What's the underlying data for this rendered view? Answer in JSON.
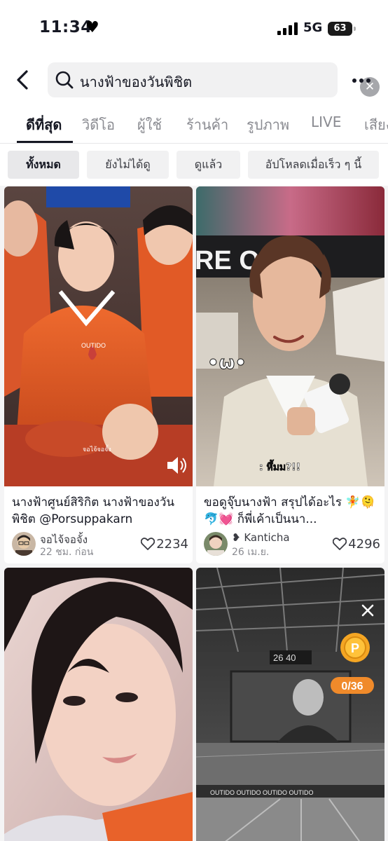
{
  "status_bar": {
    "time": "11:34",
    "network": "5G",
    "battery": "63"
  },
  "search": {
    "query": "นางฟ้าของวันพิชิต"
  },
  "tabs": [
    {
      "label": "ดีที่สุด",
      "active": true
    },
    {
      "label": "วิดีโอ"
    },
    {
      "label": "ผู้ใช้"
    },
    {
      "label": "ร้านค้า"
    },
    {
      "label": "รูปภาพ"
    },
    {
      "label": "LIVE"
    },
    {
      "label": "เสียง"
    }
  ],
  "filters": [
    {
      "label": "ทั้งหมด",
      "active": true
    },
    {
      "label": "ยังไม่ได้ดู"
    },
    {
      "label": "ดูแล้ว"
    },
    {
      "label": "อัปโหลดเมื่อเร็ว ๆ นี้"
    }
  ],
  "videos": [
    {
      "caption": "นางฟ้าศูนย์สิริกิต นางฟ้าของวันพิชิต @Porsuppakarn",
      "overlay_text": "จอไจ้จอจั้ง",
      "author": "จอไจ้จอจั้ง",
      "time": "22 ชม. ก่อน",
      "likes": "2234",
      "sound_icon": "speaker-icon"
    },
    {
      "caption": "ขอดูจุ๊บนางฟ้า สรุปได้อะไร 🧚🫠🐬💓 ก็พี่เค้าเป็นนา...",
      "overlay_text": "•ω•",
      "overlay_subtitle": ": หึ้มม?!!",
      "author": "❥ Kanticha",
      "time": "26 เม.ย.",
      "likes": "4296"
    },
    {
      "overlay_text": ""
    },
    {
      "coin_label": "P",
      "coin_progress": "0/36"
    }
  ],
  "colors": {
    "accent": "#fe2c55",
    "coin": "#f5a623",
    "jersey": "#e8622a"
  }
}
